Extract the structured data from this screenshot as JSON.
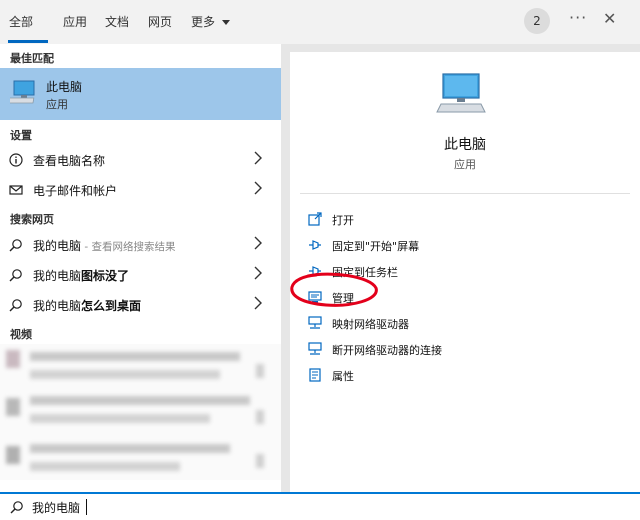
{
  "tabs": [
    {
      "label": "全部"
    },
    {
      "label": "应用"
    },
    {
      "label": "文档"
    },
    {
      "label": "网页"
    },
    {
      "label": "更多"
    }
  ],
  "top_right": {
    "badge": "2",
    "more": "···",
    "close": "✕"
  },
  "sections": {
    "best_match": "最佳匹配",
    "settings": "设置",
    "web": "搜索网页",
    "video": "视频"
  },
  "best_match": {
    "title": "此电脑",
    "subtitle": "应用",
    "icon": "pc-monitor-icon"
  },
  "settings_items": [
    {
      "label": "查看电脑名称",
      "icon": "info-icon"
    },
    {
      "label": "电子邮件和帐户",
      "icon": "mail-icon"
    }
  ],
  "web_items": [
    {
      "label": "我的电脑",
      "sub": " - 查看网络搜索结果"
    },
    {
      "label": "我的电脑图标没了"
    },
    {
      "label": "我的电脑怎么到桌面"
    }
  ],
  "detail": {
    "title": "此电脑",
    "subtitle": "应用",
    "actions": [
      {
        "label": "打开",
        "icon": "open-icon"
      },
      {
        "label": "固定到\"开始\"屏幕",
        "icon": "pin-icon"
      },
      {
        "label": "固定到任务栏",
        "icon": "pin-icon"
      },
      {
        "label": "管理",
        "icon": "manage-icon"
      },
      {
        "label": "映射网络驱动器",
        "icon": "network-drive-icon"
      },
      {
        "label": "断开网络驱动器的连接",
        "icon": "network-drive-icon"
      },
      {
        "label": "属性",
        "icon": "properties-icon"
      }
    ]
  },
  "search": {
    "value": "我的电脑"
  },
  "colors": {
    "accent": "#0078d4",
    "selection": "#9dc6ea",
    "annotation": "#e3001b"
  }
}
